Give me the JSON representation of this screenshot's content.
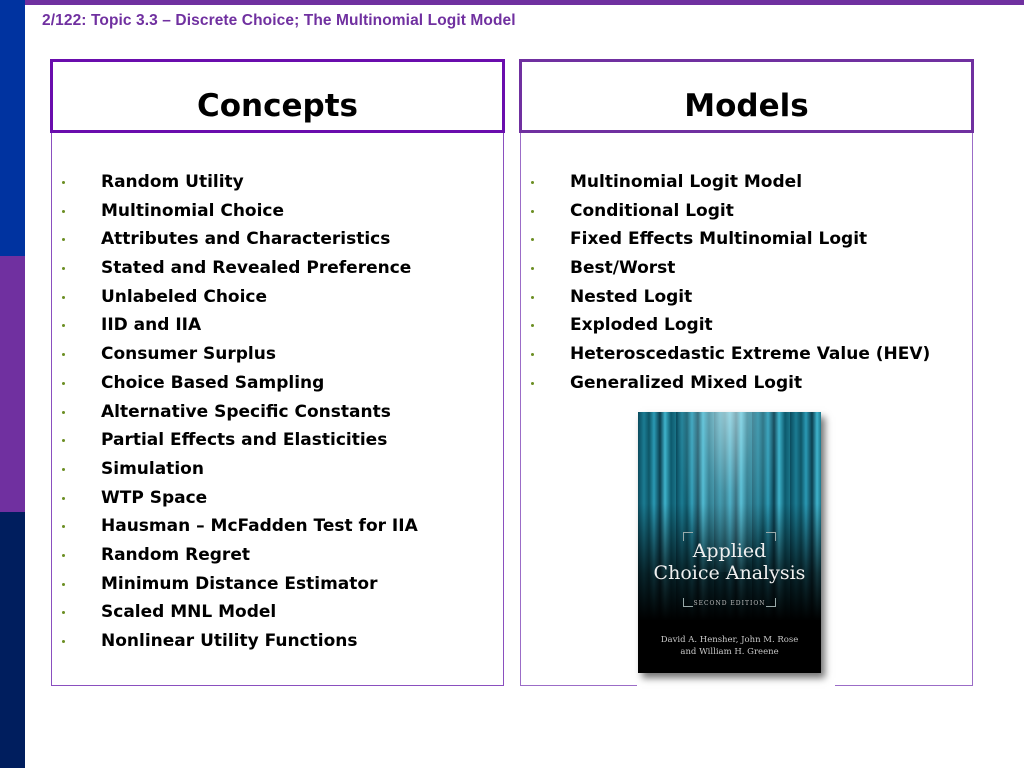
{
  "slide": {
    "title": "2/122: Topic 3.3 – Discrete Choice; The Multinomial Logit Model"
  },
  "colors": {
    "accent_purple": "#7030a0",
    "stripe_blue": "#0033a0",
    "stripe_navy": "#001e5e",
    "bullet_olive": "#6b8e23"
  },
  "concepts": {
    "heading": "Concepts",
    "items": [
      "Random Utility",
      "Multinomial Choice",
      "Attributes and Characteristics",
      "Stated and Revealed Preference",
      "Unlabeled Choice",
      "IID and IIA",
      "Consumer Surplus",
      "Choice Based Sampling",
      "Alternative Specific Constants",
      "Partial Effects and Elasticities",
      "Simulation",
      "WTP Space",
      "Hausman – McFadden Test for IIA",
      "Random Regret",
      "Minimum Distance Estimator",
      "Scaled MNL Model",
      "Nonlinear Utility Functions"
    ]
  },
  "models": {
    "heading": "Models",
    "items": [
      "Multinomial Logit Model",
      "Conditional Logit",
      "Fixed Effects Multinomial Logit",
      "Best/Worst",
      "Nested Logit",
      "Exploded Logit",
      "Heteroscedastic Extreme Value (HEV)",
      "Generalized Mixed Logit"
    ]
  },
  "book": {
    "title_line1": "Applied",
    "title_line2": "Choice Analysis",
    "edition": "SECOND EDITION",
    "authors_line1": "David A. Hensher, John M. Rose",
    "authors_line2": "and William H. Greene"
  }
}
